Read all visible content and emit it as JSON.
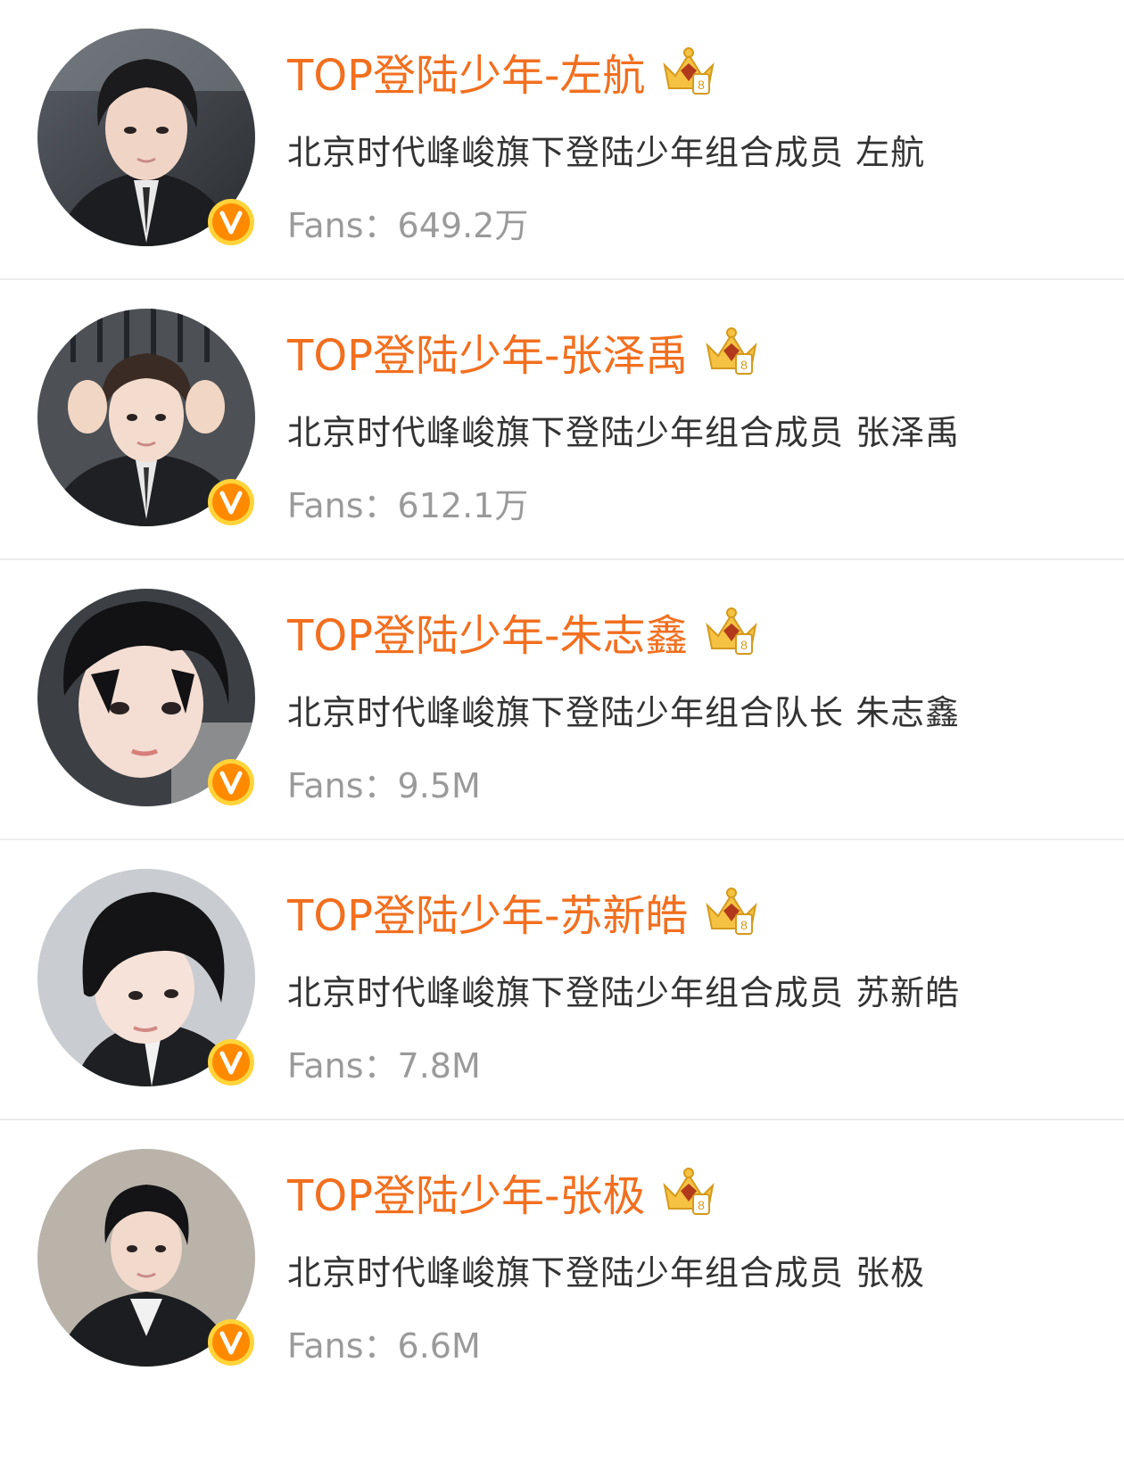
{
  "users": [
    {
      "name": "TOP登陆少年-左航",
      "description": "北京时代峰峻旗下登陆少年组合成员 左航",
      "fans_label": "Fans：",
      "fans_value": "649.2万"
    },
    {
      "name": "TOP登陆少年-张泽禹",
      "description": "北京时代峰峻旗下登陆少年组合成员 张泽禹",
      "fans_label": "Fans：",
      "fans_value": "612.1万"
    },
    {
      "name": "TOP登陆少年-朱志鑫",
      "description": "北京时代峰峻旗下登陆少年组合队长 朱志鑫",
      "fans_label": "Fans：",
      "fans_value": "9.5M"
    },
    {
      "name": "TOP登陆少年-苏新皓",
      "description": "北京时代峰峻旗下登陆少年组合成员 苏新皓",
      "fans_label": "Fans：",
      "fans_value": "7.8M"
    },
    {
      "name": "TOP登陆少年-张极",
      "description": "北京时代峰峻旗下登陆少年组合成员 张极",
      "fans_label": "Fans：",
      "fans_value": "6.6M"
    }
  ],
  "colors": {
    "name": "#f26f1f",
    "description": "#333333",
    "fans": "#9a9a9a",
    "divider": "#ececec",
    "verified_badge": "#ff8a00"
  },
  "icons": {
    "verified": "verified-v-icon",
    "crown": "crown-level-icon"
  }
}
